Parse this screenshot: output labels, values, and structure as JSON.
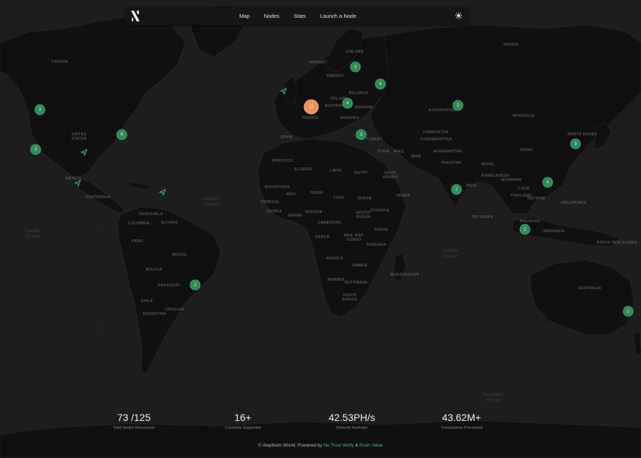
{
  "nav": {
    "links": [
      "Map",
      "Nodes",
      "Stats",
      "Launch a Node"
    ],
    "logo_icon": "alephium-logo-icon",
    "theme_icon": "sun-icon"
  },
  "map": {
    "ocean_labels": [
      "Atlantic Ocean",
      "Pacific Ocean",
      "Indian Ocean",
      "Southern Ocean"
    ],
    "country_labels": [
      "RUSSIA",
      "CANADA",
      "UNITED STATES",
      "MEXICO",
      "GUATEMALA",
      "VENEZUELA",
      "COLOMBIA",
      "GUYANA",
      "PERU",
      "BRAZIL",
      "BOLIVIA",
      "PARAGUAY",
      "CHILE",
      "ARGENTINA",
      "URUGUAY",
      "NORWAY",
      "FINLAND",
      "SWEDEN",
      "BELARUS",
      "UKRAINE",
      "POLAND",
      "FRANCE",
      "SPAIN",
      "AUSTRIA",
      "ROMANIA",
      "TURKEY",
      "SYRIA",
      "IRAQ",
      "IRAN",
      "KAZAKHSTAN",
      "MONGOLIA",
      "CHINA",
      "UZBEKISTAN",
      "TURKMENISTAN",
      "AFGHANISTAN",
      "PAKISTAN",
      "NEPAL",
      "INDIA",
      "BANGLADESH",
      "MYANMAR",
      "LAOS",
      "THAILAND",
      "VIETNAM",
      "PHILIPPINES",
      "MALAYSIA",
      "INDONESIA",
      "PAPUA NEW GUINEA",
      "AUSTRALIA",
      "NORTH KOREA",
      "MOROCCO",
      "ALGERIA",
      "LIBYA",
      "EGYPT",
      "SAUDI ARABIA",
      "YEMEN",
      "MAURITANIA",
      "MALI",
      "NIGER",
      "CHAD",
      "SUDAN",
      "SOUTH SUDAN",
      "ETHIOPIA",
      "NIGERIA",
      "SENEGAL",
      "GUINEA",
      "GHANA",
      "CAMEROON",
      "GABON",
      "DEM. REP. CONGO",
      "KENYA",
      "TANZANIA",
      "ANGOLA",
      "ZAMBIA",
      "NAMIBIA",
      "BOTSWANA",
      "MADAGASCAR",
      "SOUTH AFRICA",
      "SRI LANKA"
    ],
    "clusters": [
      {
        "count": "3"
      },
      {
        "count": "9"
      },
      {
        "count": "3"
      },
      {
        "count": "3"
      },
      {
        "count": "4"
      },
      {
        "count": "11"
      },
      {
        "count": "4"
      },
      {
        "count": "3"
      },
      {
        "count": "2"
      },
      {
        "count": "2"
      },
      {
        "count": "4"
      },
      {
        "count": "3"
      },
      {
        "count": "2"
      },
      {
        "count": "2"
      },
      {
        "count": "2"
      }
    ]
  },
  "stats": [
    {
      "value": "73 /125",
      "label": "Total Nodes Discovered"
    },
    {
      "value": "16+",
      "label": "Countries Supported"
    },
    {
      "value": "42.53PH/s",
      "label": "Network Hashrate"
    },
    {
      "value": "43.62M+",
      "label": "Transactions Processed"
    }
  ],
  "footer": {
    "prefix": "© Alephium World. Powered by",
    "link1": "No Trust Verify",
    "amp": "&",
    "link2": "Push Value"
  },
  "colors": {
    "cluster_green": "#2e8b57",
    "cluster_orange": "#f0905a",
    "arrow_green": "#3fa96b",
    "link_green": "#4fc17a"
  }
}
